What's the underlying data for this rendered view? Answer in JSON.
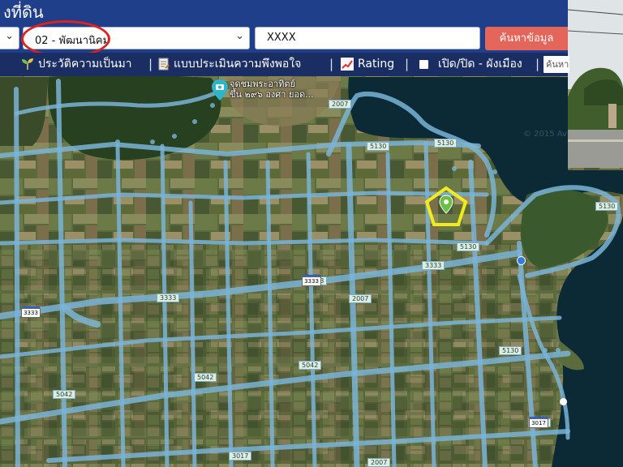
{
  "header": {
    "title": "งที่ดิน"
  },
  "search": {
    "province_value": "",
    "district_value": "02 - พัฒนานิคม",
    "parcel_value": "XXXX",
    "search_button_label": "ค้นหาข้อมูล"
  },
  "nav": {
    "items": [
      "ประวัติความเป็นมา",
      "แบบประเมินความพึงพอใจ",
      "Rating",
      "เปิด/ปิด - ผังเมือง"
    ],
    "separator": "|",
    "quick_search_placeholder": "ค้นหา"
  },
  "map": {
    "poi_label_line1": "จุดชมพระอาทิตย์",
    "poi_label_line2": "ขึ้น ๒๙๖ องศา ยอด...",
    "copyright": "© 2015 Avi",
    "road_labels": [
      "2007",
      "5130",
      "5130",
      "5130",
      "5130",
      "3333",
      "3333",
      "3333",
      "2007",
      "5042",
      "5042",
      "5042",
      "5130",
      "3017",
      "3017",
      "2007"
    ],
    "highway_shields": [
      "3333",
      "3333",
      "3017"
    ],
    "colors": {
      "road_overlay": "#7ab4d6",
      "water": "#0c2a36",
      "highlight_ellipse": "#e0211f",
      "marker_pentagon": "#f2ea1c",
      "marker_pin": "#6cbf45"
    }
  },
  "colors": {
    "header_bg": "#1f3f8a",
    "nav_bg": "#1a2e63",
    "search_button": "#e4665a"
  }
}
